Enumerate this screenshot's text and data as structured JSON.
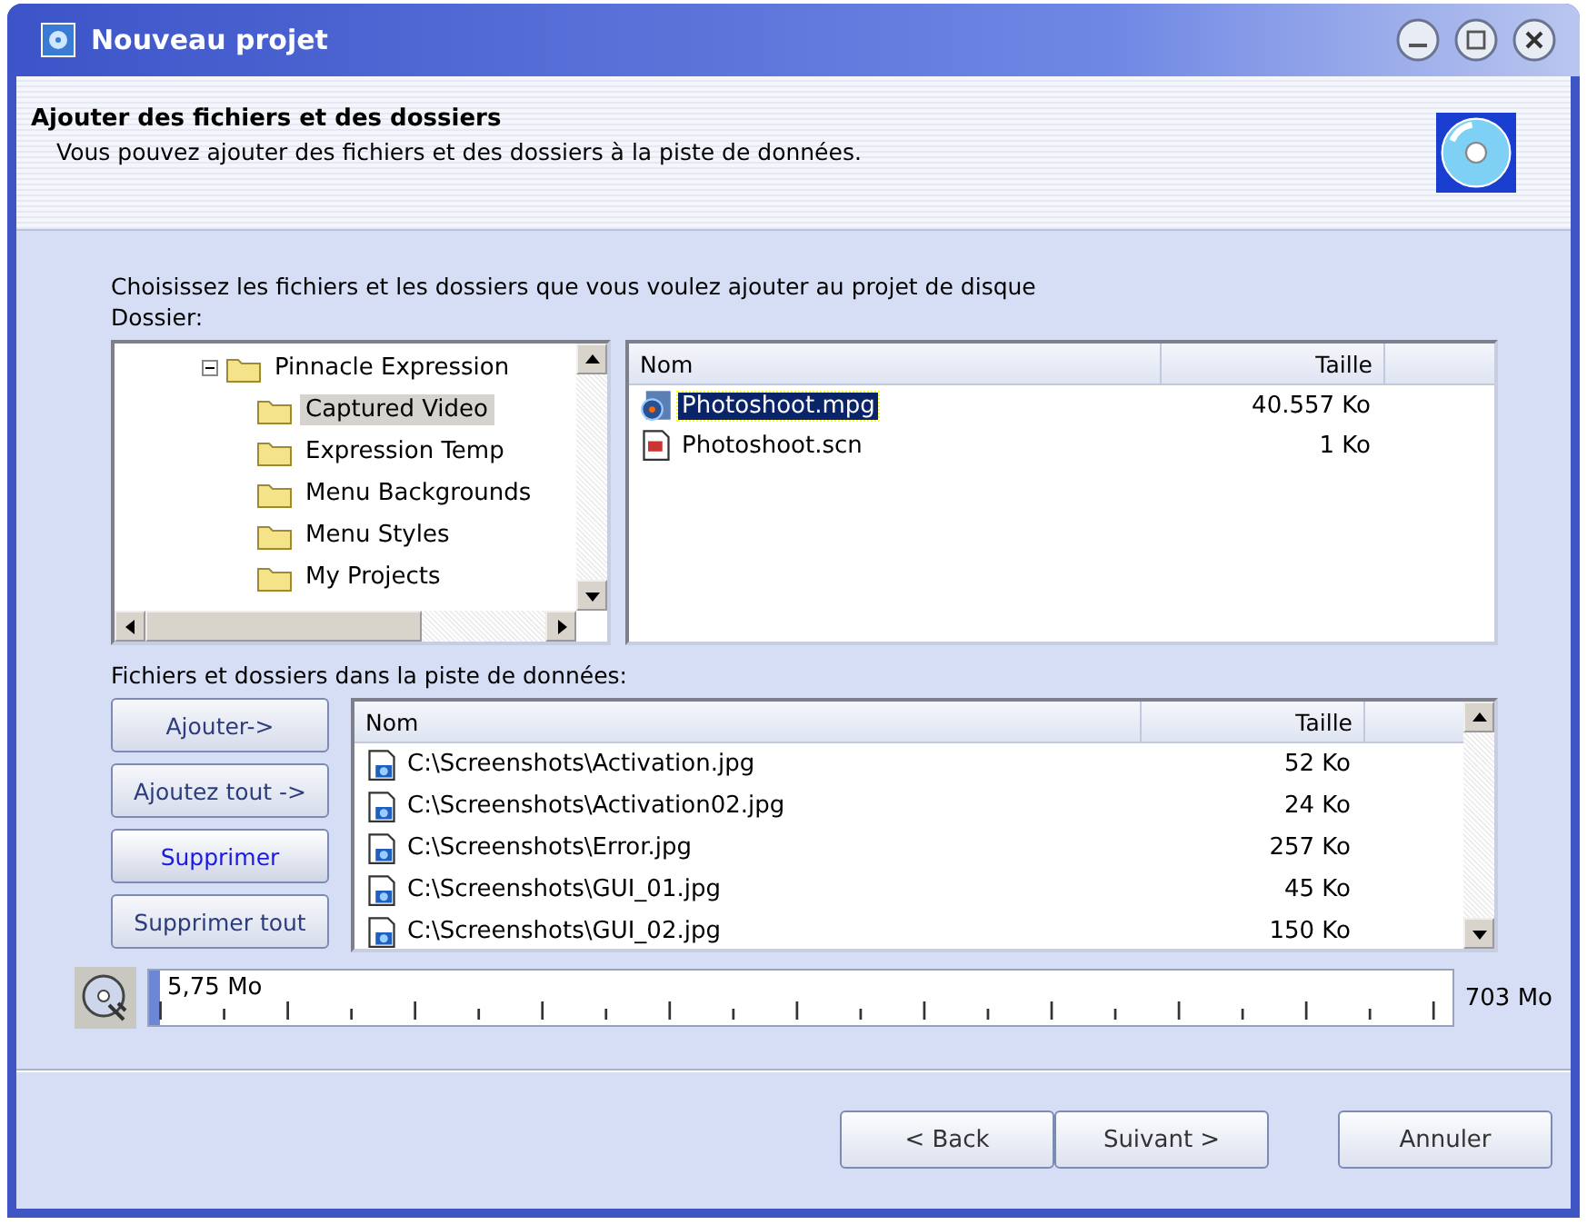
{
  "window": {
    "title": "Nouveau projet"
  },
  "header": {
    "title": "Ajouter des fichiers et des dossiers",
    "subtitle": "Vous pouvez ajouter des fichiers et des dossiers à la piste de données."
  },
  "instruction": "Choisissez les fichiers et les dossiers que vous voulez ajouter au projet de disque",
  "folder_label": "Dossier:",
  "tree": [
    {
      "label": "Pinnacle Expression",
      "expanded": true,
      "selected": false,
      "children": [
        {
          "label": "Captured Video",
          "selected": true
        },
        {
          "label": "Expression Temp",
          "selected": false
        },
        {
          "label": "Menu Backgrounds",
          "selected": false
        },
        {
          "label": "Menu Styles",
          "selected": false
        },
        {
          "label": "My Projects",
          "selected": false
        }
      ]
    }
  ],
  "files": {
    "columns": [
      "Nom",
      "Taille"
    ],
    "rows": [
      {
        "name": "Photoshoot.mpg",
        "size": "40.557 Ko",
        "kind": "video",
        "selected": true
      },
      {
        "name": "Photoshoot.scn",
        "size": "1 Ko",
        "kind": "scene",
        "selected": false
      }
    ]
  },
  "track_label": "Fichiers et dossiers dans la piste de données:",
  "actions": [
    {
      "label": "Ajouter->",
      "focused": false
    },
    {
      "label": "Ajoutez tout ->",
      "focused": false
    },
    {
      "label": "Supprimer",
      "focused": true
    },
    {
      "label": "Supprimer tout",
      "focused": false
    }
  ],
  "track": {
    "columns": [
      "Nom",
      "Taille"
    ],
    "rows": [
      {
        "name": "C:\\Screenshots\\Activation.jpg",
        "size": "52 Ko"
      },
      {
        "name": "C:\\Screenshots\\Activation02.jpg",
        "size": "24 Ko"
      },
      {
        "name": "C:\\Screenshots\\Error.jpg",
        "size": "257 Ko"
      },
      {
        "name": "C:\\Screenshots\\GUI_01.jpg",
        "size": "45 Ko"
      },
      {
        "name": "C:\\Screenshots\\GUI_02.jpg",
        "size": "150 Ko"
      }
    ]
  },
  "capacity": {
    "used": "5,75 Mo",
    "total": "703 Mo",
    "level": 0.008
  },
  "buttons": [
    {
      "label": "< Back"
    },
    {
      "label": "Suivant >"
    },
    {
      "label": "Annuler"
    }
  ]
}
